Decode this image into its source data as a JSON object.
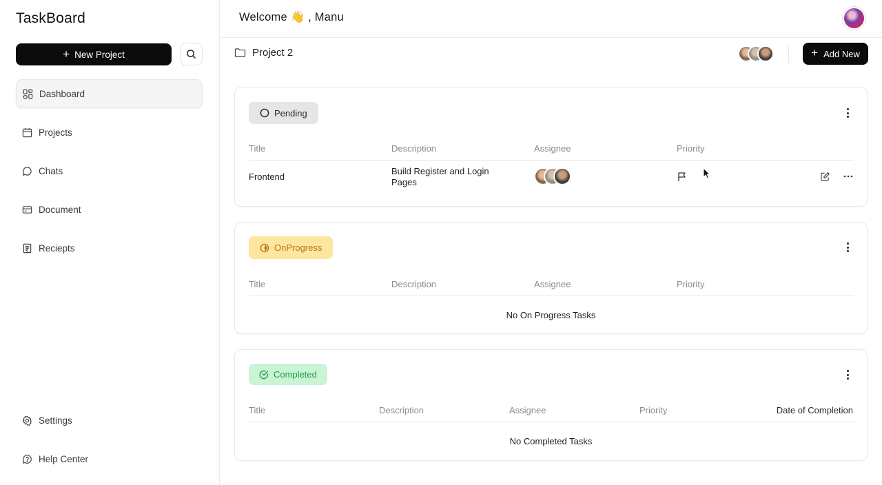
{
  "app": {
    "brand": "TaskBoard"
  },
  "sidebar": {
    "new_project_label": "New Project",
    "items": [
      {
        "label": "Dashboard",
        "icon": "dashboard-icon",
        "active": true
      },
      {
        "label": "Projects",
        "icon": "calendar-icon"
      },
      {
        "label": "Chats",
        "icon": "chat-icon"
      },
      {
        "label": "Document",
        "icon": "card-icon"
      },
      {
        "label": "Reciepts",
        "icon": "receipt-icon"
      }
    ],
    "bottom_items": [
      {
        "label": "Settings",
        "icon": "gear-icon"
      },
      {
        "label": "Help Center",
        "icon": "help-icon"
      }
    ]
  },
  "header": {
    "welcome": "Welcome 👋 , Manu"
  },
  "project": {
    "title": "Project 2",
    "add_new_label": "Add New"
  },
  "sections": {
    "pending": {
      "status": "Pending",
      "columns": [
        "Title",
        "Description",
        "Assignee",
        "Priority"
      ],
      "rows": [
        {
          "title": "Frontend",
          "description_line1": "Build Register and Login",
          "description_line2": "Pages"
        }
      ]
    },
    "progress": {
      "status": "OnProgress",
      "columns": [
        "Title",
        "Description",
        "Assignee",
        "Priority"
      ],
      "empty": "No On Progress Tasks"
    },
    "completed": {
      "status": "Completed",
      "columns": [
        "Title",
        "Description",
        "Assignee",
        "Priority",
        "Date of Completion"
      ],
      "empty": "No Completed Tasks"
    }
  },
  "colors": {
    "primary": "#0b0b0b",
    "pending_bg": "#e6e6e8",
    "progress_bg": "#fde7a0",
    "progress_text": "#b27b08",
    "completed_bg": "#c9f4d6",
    "completed_text": "#1f9b4b"
  }
}
